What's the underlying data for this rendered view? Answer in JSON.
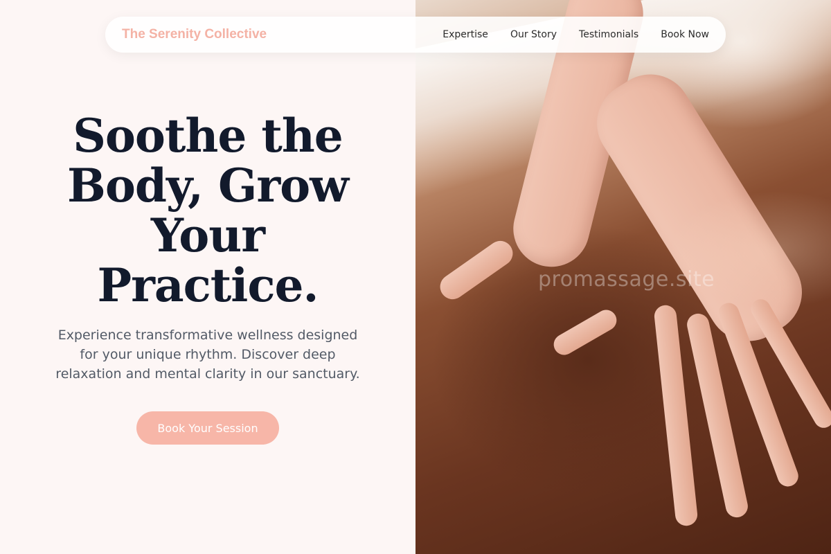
{
  "brand": {
    "name": "The Serenity Collective",
    "color": "#f4b2a5"
  },
  "nav": {
    "items": [
      {
        "label": "Expertise"
      },
      {
        "label": "Our Story"
      },
      {
        "label": "Testimonials"
      },
      {
        "label": "Book Now"
      }
    ]
  },
  "hero": {
    "headline": "Soothe the Body, Grow Your Practice.",
    "subtext": "Experience transformative wellness designed for your unique rhythm. Discover deep relaxation and mental clarity in our sanctuary.",
    "cta_label": "Book Your Session",
    "image_watermark": "promassage.site"
  },
  "colors": {
    "accent": "#f7b6a8",
    "headline": "#121a2c",
    "background": "#fdf6f5"
  }
}
